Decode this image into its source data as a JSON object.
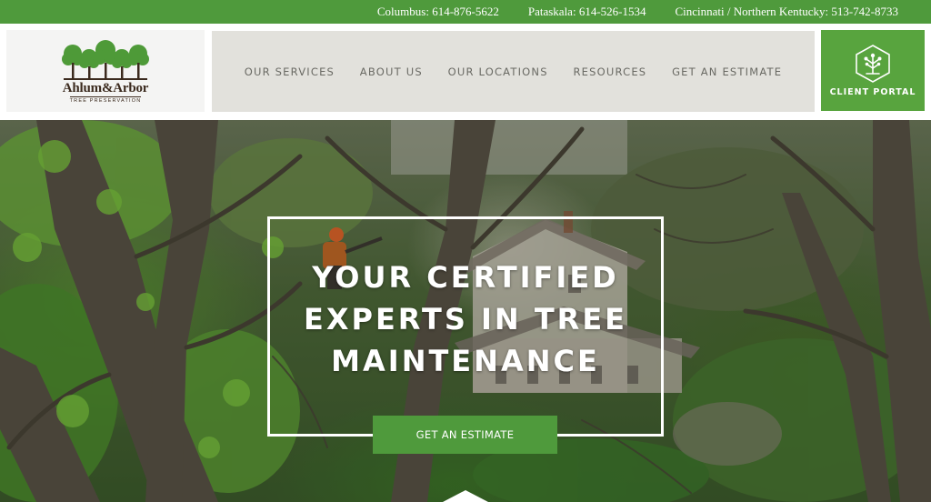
{
  "topbar": {
    "phones": [
      "Columbus: 614-876-5622",
      "Pataskala: 614-526-1534",
      "Cincinnati / Northern Kentucky: 513-742-8733"
    ],
    "background": "#4f9a3c"
  },
  "logo": {
    "name": "Ahlum&Arbor",
    "subtitle": "TREE PRESERVATION",
    "tree_color": "#4e9a38",
    "text_color": "#3b2a1e"
  },
  "nav": {
    "items": [
      "OUR SERVICES",
      "ABOUT US",
      "OUR LOCATIONS",
      "RESOURCES",
      "GET AN ESTIMATE"
    ],
    "background": "#e2e1dc"
  },
  "client_portal": {
    "label": "CLIENT PORTAL",
    "icon": "tree-hexagon-icon",
    "background": "#58a43e"
  },
  "hero": {
    "title_lines": [
      "YOUR CERTIFIED",
      "EXPERTS IN TREE",
      "MAINTENANCE"
    ],
    "cta_label": "GET AN ESTIMATE",
    "scroll_icon": "chevron-down-icon"
  }
}
